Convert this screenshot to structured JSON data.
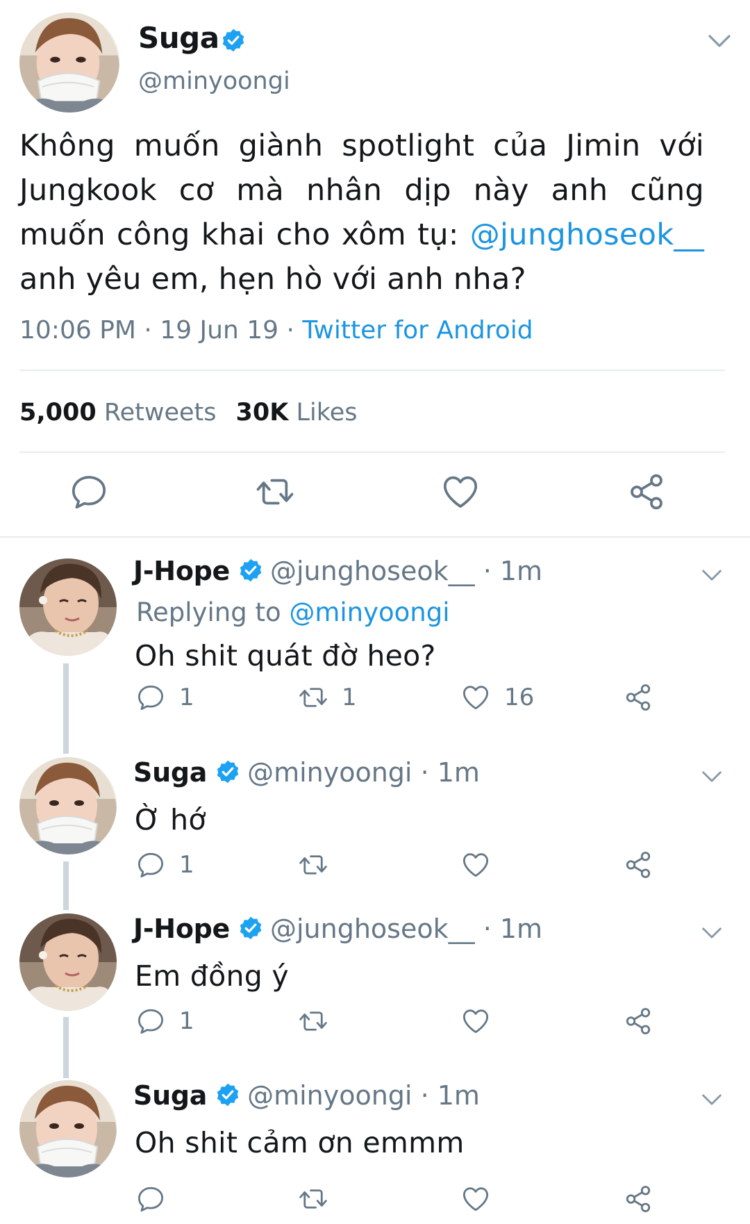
{
  "main_tweet": {
    "name": "Suga",
    "handle": "@minyoongi",
    "text_before": "Không muốn giành spotlight của Jimin với Jungkook cơ mà nhân dịp này anh cũng muốn công khai cho xôm tụ: ",
    "mention": "@junghoseok__",
    "text_after": " anh yêu em, hẹn hò với anh nha?",
    "time": "10:06 PM · 19 Jun 19 · ",
    "source": "Twitter for Android",
    "retweets_count": "5,000",
    "retweets_label": "Retweets",
    "likes_count": "30K",
    "likes_label": "Likes",
    "icons": [
      "reply-icon",
      "retweet-icon",
      "heart-icon",
      "share-icon"
    ]
  },
  "replies": [
    {
      "name": "J-Hope",
      "handle": "@junghoseok__ · 1m",
      "replying_label": "Replying to ",
      "replying_to": "@minyoongi",
      "text": "Oh shit quát đờ heo?",
      "reply_count": "1",
      "retweet_count": "1",
      "like_count": "16"
    },
    {
      "name": "Suga",
      "handle": "@minyoongi · 1m",
      "text": "Ờ hớ",
      "reply_count": "1",
      "retweet_count": "",
      "like_count": ""
    },
    {
      "name": "J-Hope",
      "handle": "@junghoseok__ · 1m",
      "text": "Em đồng ý",
      "reply_count": "1",
      "retweet_count": "",
      "like_count": ""
    },
    {
      "name": "Suga",
      "handle": "@minyoongi · 1m",
      "text": "Oh shit cảm ơn emmm",
      "reply_count": "",
      "retweet_count": "",
      "like_count": ""
    }
  ],
  "colors": {
    "accent": "#1b95e0",
    "text": "#14171a",
    "muted": "#657786",
    "divider": "#e6ecf0",
    "thread_line": "#ccd6dd"
  }
}
